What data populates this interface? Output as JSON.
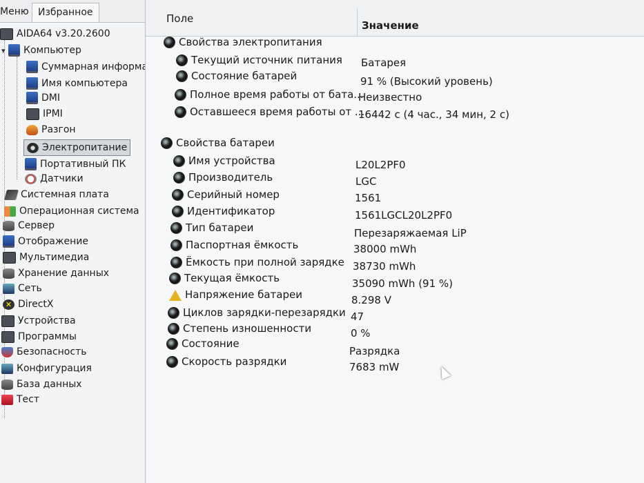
{
  "tabs": {
    "menu": "Меню",
    "favorites": "Избранное"
  },
  "tree": {
    "root": "AIDA64 v3.20.2600",
    "computer": "Компьютер",
    "computer_children": [
      "Суммарная информа",
      "Имя компьютера",
      "DMI",
      "IPMI",
      "Разгон",
      "Электропитание",
      "Портативный ПК",
      "Датчики"
    ],
    "categories": [
      "Системная плата",
      "Операционная система",
      "Сервер",
      "Отображение",
      "Мультимедиа",
      "Хранение данных",
      "Сеть",
      "DirectX",
      "Устройства",
      "Программы",
      "Безопасность",
      "Конфигурация",
      "База данных",
      "Тест"
    ]
  },
  "header": {
    "field": "Поле",
    "value": "Значение"
  },
  "power": {
    "group": "Свойства электропитания",
    "rows": [
      {
        "field": "Текущий источник питания",
        "value": "Батарея"
      },
      {
        "field": "Состояние батарей",
        "value": "91 % (Высокий уровень)"
      },
      {
        "field": "Полное время работы от бата...",
        "value": "Неизвестно"
      },
      {
        "field": "Оставшееся время работы от ...",
        "value": "16442 с (4 час., 34 мин, 2 с)"
      }
    ]
  },
  "battery": {
    "group": "Свойства батареи",
    "rows": [
      {
        "field": "Имя устройства",
        "value": "L20L2PF0"
      },
      {
        "field": "Производитель",
        "value": "LGC"
      },
      {
        "field": "Серийный номер",
        "value": "1561"
      },
      {
        "field": "Идентификатор",
        "value": "1561LGCL20L2PF0"
      },
      {
        "field": "Тип батареи",
        "value": "Перезаряжаемая LiP"
      },
      {
        "field": "Паспортная ёмкость",
        "value": "38000 mWh"
      },
      {
        "field": "Ёмкость при полной зарядке",
        "value": "38730 mWh"
      },
      {
        "field": "Текущая ёмкость",
        "value": "35090 mWh  (91 %)"
      },
      {
        "field": "Напряжение батареи",
        "value": "8.298 V"
      },
      {
        "field": "Циклов зарядки-перезарядки",
        "value": "47"
      },
      {
        "field": "Степень изношенности",
        "value": "0 %"
      },
      {
        "field": "Состояние",
        "value": "Разрядка"
      },
      {
        "field": "Скорость разрядки",
        "value": "7683 mW"
      }
    ]
  },
  "icons": {
    "battery_row": "battery-gear-icon",
    "voltage_row": "warning-icon"
  }
}
